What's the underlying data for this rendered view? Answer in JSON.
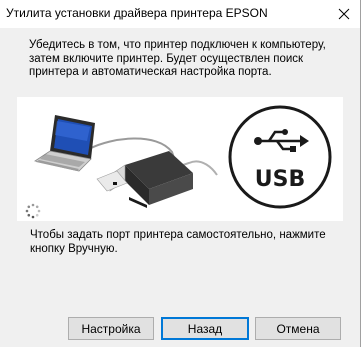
{
  "window": {
    "title": "Утилита установки драйвера принтера EPSON"
  },
  "instructions": {
    "intro": "Убедитесь в том, что принтер подключен к компьютеру,\nзатем включите принтер. Будет осуществлен поиск\nпринтера и автоматическая настройка порта.",
    "manual_hint": "Чтобы задать порт принтера самостоятельно, нажмите\nкнопку Вручную."
  },
  "illustration": {
    "usb_label": "USB",
    "icons": [
      "laptop-icon",
      "printer-icon",
      "usb-symbol-icon",
      "loading-spinner-icon"
    ]
  },
  "buttons": {
    "settings": "Настройка",
    "back": "Назад",
    "cancel": "Отмена"
  },
  "colors": {
    "background": "#f0f0f0",
    "panel": "#ffffff",
    "button_face": "#e1e1e1",
    "default_button_border": "#0078d7",
    "usb_circle": "#1a1a1a"
  }
}
